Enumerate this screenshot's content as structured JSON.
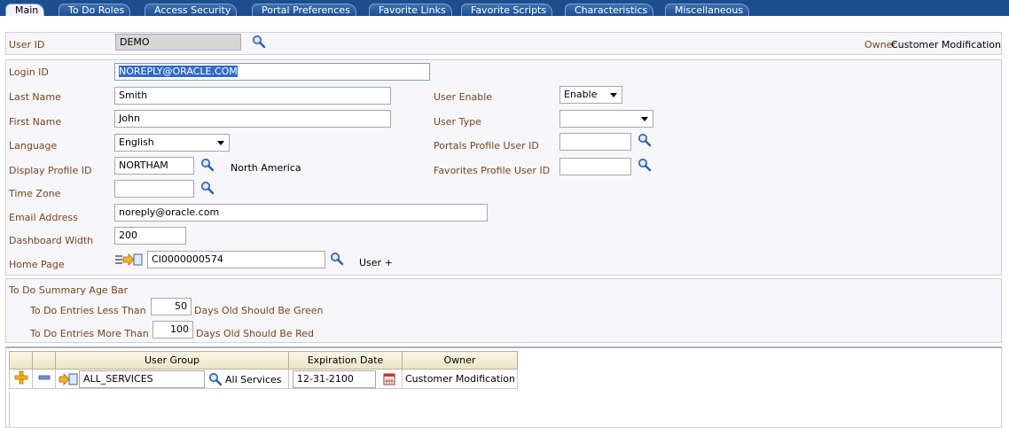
{
  "tabs": [
    {
      "label": "Main",
      "active": true
    },
    {
      "label": "To Do Roles"
    },
    {
      "label": "Access Security"
    },
    {
      "label": "Portal Preferences"
    },
    {
      "label": "Favorite Links"
    },
    {
      "label": "Favorite Scripts"
    },
    {
      "label": "Characteristics"
    },
    {
      "label": "Miscellaneous"
    }
  ],
  "header": {
    "user_id_label": "User ID",
    "user_id_value": "DEMO",
    "owner_label": "Owner",
    "owner_value": "Customer Modification"
  },
  "main": {
    "login_id_label": "Login ID",
    "login_id_value": "NOREPLY@ORACLE.COM",
    "last_name_label": "Last Name",
    "last_name_value": "Smith",
    "first_name_label": "First Name",
    "first_name_value": "John",
    "language_label": "Language",
    "language_value": "English",
    "display_profile_label": "Display Profile ID",
    "display_profile_value": "NORTHAM",
    "display_profile_desc": "North America",
    "time_zone_label": "Time Zone",
    "time_zone_value": "",
    "email_label": "Email Address",
    "email_value": "noreply@oracle.com",
    "dashboard_width_label": "Dashboard Width",
    "dashboard_width_value": "200",
    "home_page_label": "Home Page",
    "home_page_value": "CI0000000574",
    "home_page_desc": "User +",
    "user_enable_label": "User Enable",
    "user_enable_value": "Enable",
    "user_type_label": "User Type",
    "user_type_value": "",
    "portals_profile_label": "Portals Profile User ID",
    "portals_profile_value": "",
    "favorites_profile_label": "Favorites Profile User ID",
    "favorites_profile_value": ""
  },
  "todo": {
    "section_label": "To Do Summary Age Bar",
    "less_label": "To Do Entries Less Than",
    "less_value": "50",
    "less_suffix": "Days Old Should Be Green",
    "more_label": "To Do Entries More Than",
    "more_value": "100",
    "more_suffix": "Days Old Should Be Red"
  },
  "grid": {
    "headers": [
      "User Group",
      "Expiration Date",
      "Owner"
    ],
    "rows": [
      {
        "user_group": "ALL_SERVICES",
        "group_desc": "All Services",
        "expiration": "12-31-2100",
        "owner": "Customer Modification"
      }
    ]
  },
  "colors": {
    "tabstrip": "#1d4d8c",
    "label": "#7a4419",
    "selection": "#316ac5"
  }
}
